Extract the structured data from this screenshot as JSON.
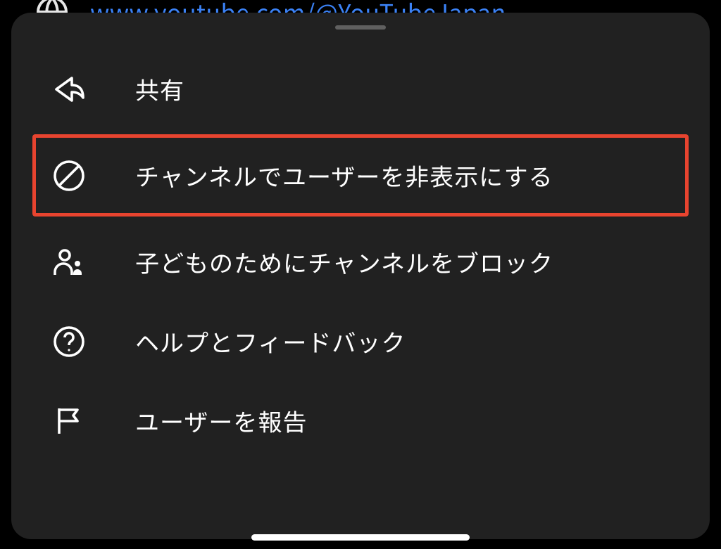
{
  "background": {
    "url_text": "www.youtube.com/@YouTubeJapan"
  },
  "menu": {
    "items": [
      {
        "icon": "share-icon",
        "label": "共有"
      },
      {
        "icon": "block-icon",
        "label": "チャンネルでユーザーを非表示にする"
      },
      {
        "icon": "family-icon",
        "label": "子どものためにチャンネルをブロック"
      },
      {
        "icon": "help-icon",
        "label": "ヘルプとフィードバック"
      },
      {
        "icon": "flag-icon",
        "label": "ユーザーを報告"
      }
    ],
    "highlighted_index": 1
  },
  "colors": {
    "highlight": "#e8442f",
    "sheet_bg": "#212121",
    "link": "#3b82f6"
  }
}
